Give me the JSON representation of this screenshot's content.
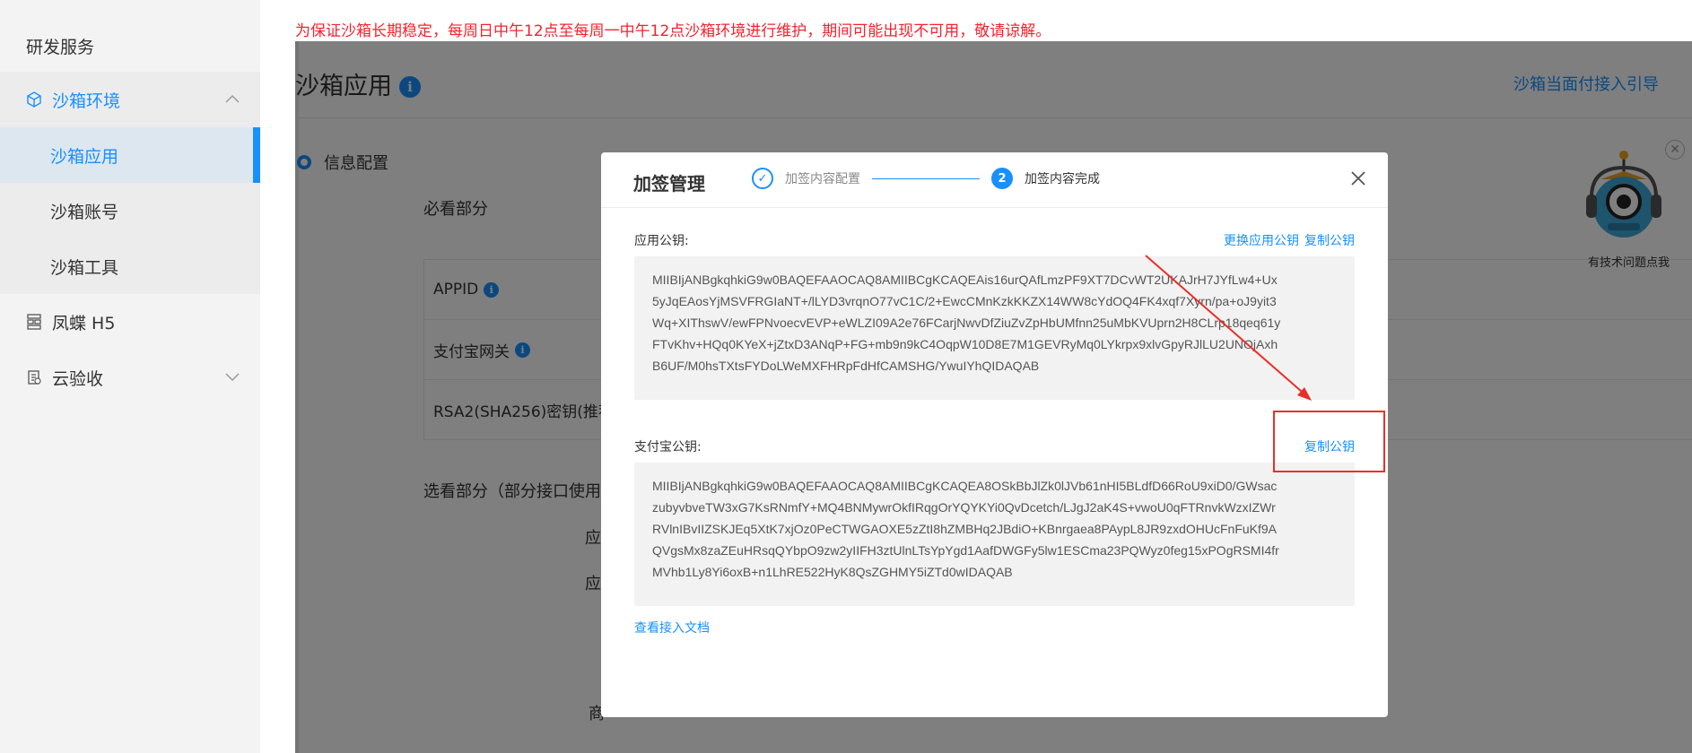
{
  "sidebar": {
    "section": "研发服务",
    "items": [
      {
        "label": "沙箱环境",
        "icon": "cube-icon"
      },
      {
        "label": "沙箱应用"
      },
      {
        "label": "沙箱账号"
      },
      {
        "label": "沙箱工具"
      },
      {
        "label": "凤蝶 H5",
        "icon": "grid-icon"
      },
      {
        "label": "云验收",
        "icon": "clipboard-icon"
      }
    ]
  },
  "notice": "为保证沙箱长期稳定，每周日中午12点至每周一中午12点沙箱环境进行维护，期间可能出现不可用，敬请谅解。",
  "page": {
    "title": "沙箱应用",
    "guide_link": "沙箱当面付接入引导",
    "step_label": "信息配置",
    "must_read": "必看部分",
    "rows": [
      "APPID",
      "支付宝网关",
      "RSA2(SHA256)密钥(推荐"
    ],
    "optional": "选看部分（部分接口使用）",
    "fragments": [
      "应",
      "应",
      "商"
    ]
  },
  "robot": {
    "label": "有技术问题点我"
  },
  "modal": {
    "title": "加签管理",
    "steps": [
      {
        "label": "加签内容配置",
        "status": "done"
      },
      {
        "label": "加签内容完成",
        "status": "active",
        "number": "2"
      }
    ],
    "app_key": {
      "label": "应用公钥:",
      "change_link": "更换应用公钥",
      "copy_link": "复制公钥",
      "lines": [
        "MIIBIjANBgkqhkiG9w0BAQEFAAOCAQ8AMIIBCgKCAQEAis16urQAfLmzPF9XT7DCvWT2UKAJrH7JYfLw4+Ux",
        "5yJqEAosYjMSVFRGIaNT+/lLYD3vrqnO77vC1C/2+EwcCMnKzkKKZX14WW8cYdOQ4FK4xqf7Xyrn/pa+oJ9yit3",
        "Wq+XIThswV/ewFPNvoecvEVP+eWLZI09A2e76FCarjNwvDfZiuZvZpHbUMfnn25uMbKVUprn2H8CLrp18qeq61y",
        "FTvKhv+HQq0KYeX+jZtxD3ANqP+FG+mb9n9kC4OqpW10D8E7M1GEVRyMq0LYkrpx9xlvGpyRJlLU2UNOjAxh",
        "B6UF/M0hsTXtsFYDoLWeMXFHRpFdHfCAMSHG/YwuIYhQIDAQAB"
      ]
    },
    "alipay_key": {
      "label": "支付宝公钥:",
      "copy_link": "复制公钥",
      "lines": [
        "MIIBIjANBgkqhkiG9w0BAQEFAAOCAQ8AMIIBCgKCAQEA8OSkBbJlZk0lJVb61nHI5BLdfD66RoU9xiD0/GWsac",
        "zubyvbveTW3xG7KsRNmfY+MQ4BNMywrOkfIRqgOrYQYKYi0QvDcetch/LJgJ2aK4S+vwoU0qFTRnvkWzxIZWr",
        "RVlnIBvIIZSKJEq5XtK7xjOz0PeCTWGAOXE5zZtI8hZMBHq2JBdiO+KBnrgaea8PAypL8JR9zxdOHUcFnFuKf9A",
        "QVgsMx8zaZEuHRsqQYbpO9zw2yIIFH3ztUlnLTsYpYgd1AafDWGFy5lw1ESCma23PQWyz0feg15xPOgRSMI4fr",
        "MVhb1Ly8Yi6oxB+n1LhRE522HyK8QsZGHMY5iZTd0wIDAQAB"
      ]
    },
    "doc_link": "查看接入文档"
  },
  "colors": {
    "accent": "#1890ff",
    "notice": "#f5222d",
    "annotation": "#e8302a"
  }
}
